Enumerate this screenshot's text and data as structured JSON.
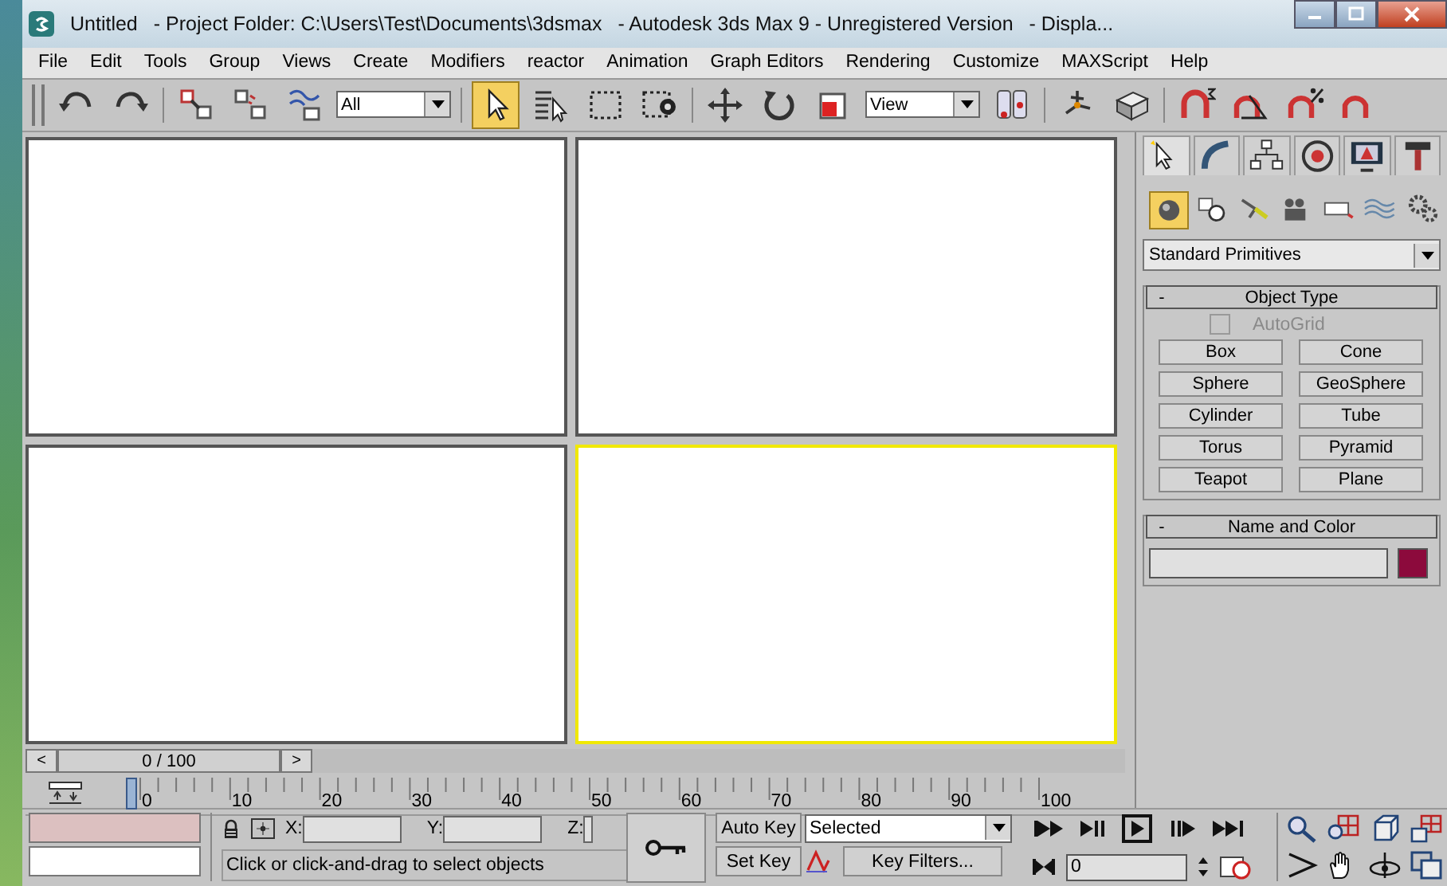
{
  "window": {
    "title_parts": [
      "Untitled",
      "- Project Folder: C:\\Users\\Test\\Documents\\3dsmax",
      "- Autodesk 3ds Max 9  - Unregistered Version",
      "- Displa..."
    ]
  },
  "menu": [
    "File",
    "Edit",
    "Tools",
    "Group",
    "Views",
    "Create",
    "Modifiers",
    "reactor",
    "Animation",
    "Graph Editors",
    "Rendering",
    "Customize",
    "MAXScript",
    "Help"
  ],
  "toolbar": {
    "selection_filter": "All",
    "reference_coordinate": "View",
    "tools": [
      {
        "selected": false
      },
      {
        "selected": false
      },
      {
        "selected": false
      },
      {
        "selected": false
      },
      {
        "selected": false
      },
      {
        "selected": true
      },
      {
        "selected": false
      },
      {
        "selected": false
      },
      {
        "selected": false
      },
      {
        "selected": false
      },
      {
        "selected": false
      },
      {
        "selected": false
      },
      {
        "selected": false
      },
      {
        "selected": false
      },
      {
        "selected": false
      },
      {
        "selected": false
      },
      {
        "selected": false
      },
      {
        "selected": false
      },
      {
        "selected": false
      }
    ]
  },
  "viewports": [
    {
      "active": false
    },
    {
      "active": false
    },
    {
      "active": false
    },
    {
      "active": true
    }
  ],
  "command_panel": {
    "tabs": [
      {
        "selected": true
      },
      {
        "selected": false
      },
      {
        "selected": false
      },
      {
        "selected": false
      },
      {
        "selected": false
      },
      {
        "selected": false
      }
    ],
    "categories": [
      {
        "selected": true
      },
      {
        "selected": false
      },
      {
        "selected": false
      },
      {
        "selected": false
      },
      {
        "selected": false
      },
      {
        "selected": false
      },
      {
        "selected": false
      }
    ],
    "type_dropdown": "Standard Primitives",
    "object_type": {
      "title": "Object Type",
      "toggle": "-",
      "autogrid": {
        "label": "AutoGrid",
        "checked": false,
        "disabled": true
      },
      "buttons": [
        "Box",
        "Cone",
        "Sphere",
        "GeoSphere",
        "Cylinder",
        "Tube",
        "Torus",
        "Pyramid",
        "Teapot",
        "Plane"
      ]
    },
    "name_and_color": {
      "title": "Name and Color",
      "toggle": "-",
      "color": "#8c0a3c"
    }
  },
  "time_slider": {
    "prev": "<",
    "position": "0 / 100",
    "next": ">"
  },
  "track_bar": {
    "labels": [
      "0",
      "10",
      "20",
      "30",
      "40",
      "50",
      "60",
      "70",
      "80",
      "90",
      "100"
    ]
  },
  "status": {
    "x_label": "X:",
    "y_label": "Y:",
    "z_label": "Z:",
    "prompt": "Click or click-and-drag to select objects",
    "auto_key": "Auto Key",
    "set_key": "Set Key",
    "key_mode": "Selected",
    "key_filters": "Key Filters...",
    "current_frame": "0"
  }
}
